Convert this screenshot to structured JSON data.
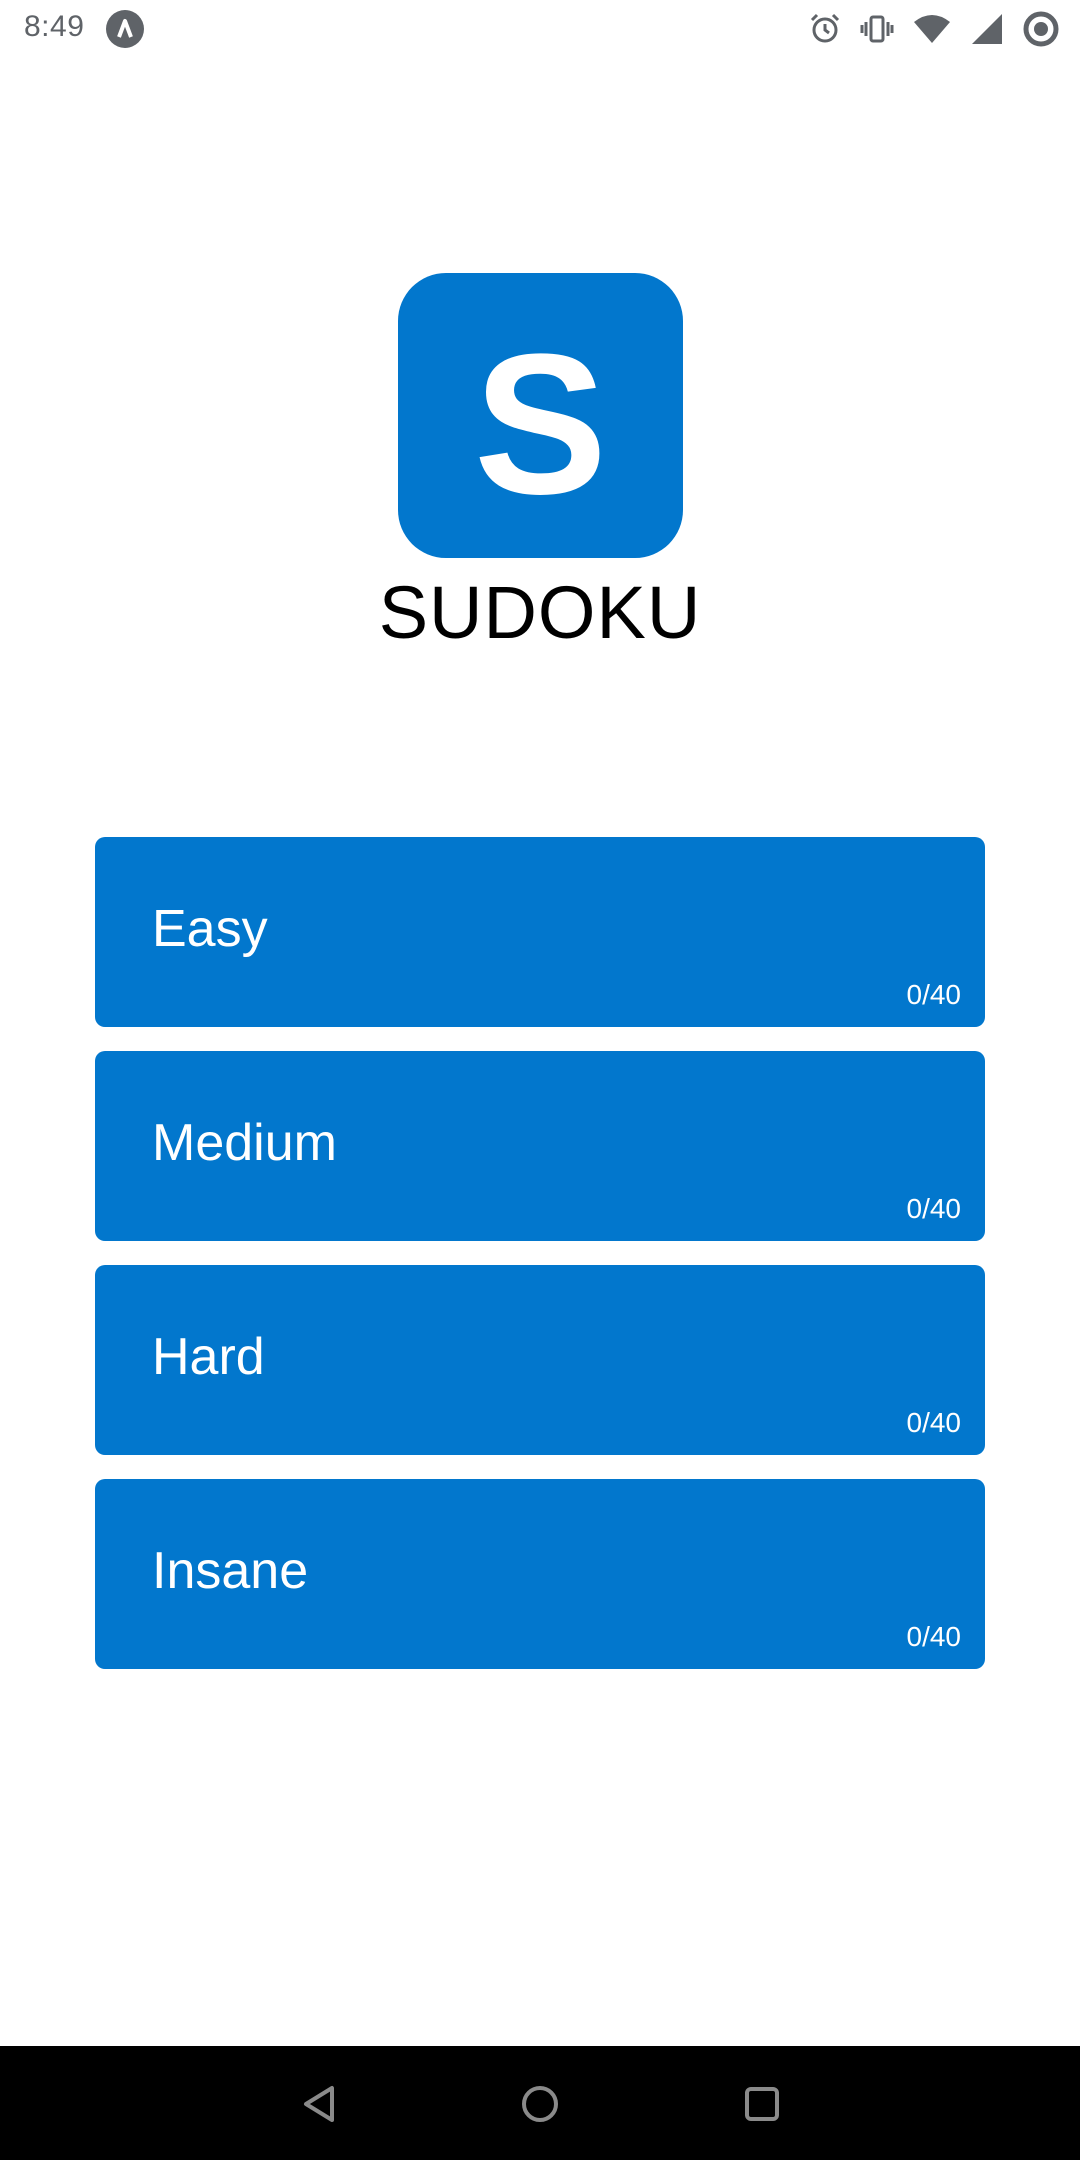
{
  "status_bar": {
    "time": "8:49",
    "icons": [
      "app-notification-icon",
      "alarm-icon",
      "vibrate-icon",
      "wifi-icon",
      "signal-icon",
      "circle-status-icon"
    ]
  },
  "logo": {
    "letter": "S",
    "color": "#0277cd"
  },
  "app_title": "SUDOKU",
  "levels": [
    {
      "name": "Easy",
      "progress": "0/40"
    },
    {
      "name": "Medium",
      "progress": "0/40"
    },
    {
      "name": "Hard",
      "progress": "0/40"
    },
    {
      "name": "Insane",
      "progress": "0/40"
    }
  ],
  "nav_bar": {
    "icons": [
      "back-icon",
      "home-icon",
      "recents-icon"
    ]
  }
}
